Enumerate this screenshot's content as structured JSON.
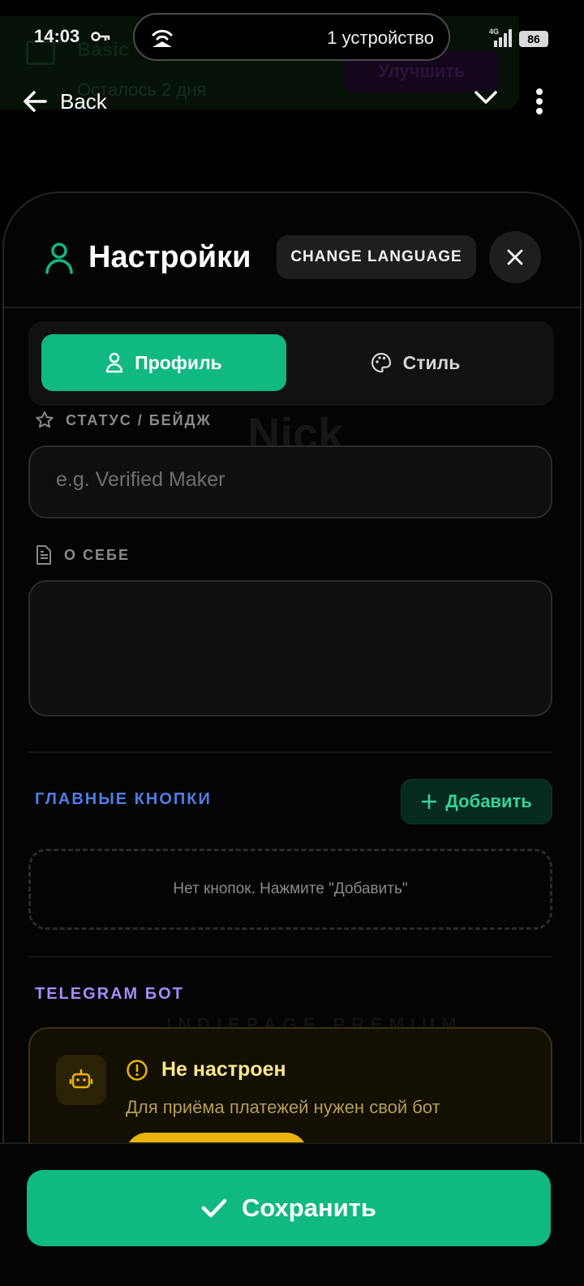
{
  "status_bar": {
    "time": "14:03",
    "devices": "1 устройство",
    "network": "4G",
    "battery": "86"
  },
  "background": {
    "trial_title": "Basic",
    "trial_remaining": "Осталось 2 дня",
    "upgrade_label": "Улучшить",
    "ghost_name": "Nick",
    "ghost_premium": "INDIEPAGE PREMIUM"
  },
  "header": {
    "back_label": "Back"
  },
  "sheet": {
    "title": "Настройки",
    "change_language": "CHANGE LANGUAGE",
    "tabs": [
      {
        "label": "Профиль",
        "active": true
      },
      {
        "label": "Стиль",
        "active": false
      }
    ],
    "status_badge": {
      "label": "СТАТУС / БЕЙДЖ",
      "placeholder": "e.g. Verified Maker",
      "value": ""
    },
    "about": {
      "label": "О СЕБЕ",
      "value": ""
    },
    "main_buttons": {
      "title": "ГЛАВНЫЕ КНОПКИ",
      "add_label": "Добавить",
      "empty_text": "Нет кнопок. Нажмите \"Добавить\""
    },
    "telegram_bot": {
      "title": "TELEGRAM БОТ",
      "status": "Не настроен",
      "description": "Для приёма платежей нужен свой бот"
    }
  },
  "footer": {
    "save_label": "Сохранить"
  },
  "colors": {
    "accent": "#10b981",
    "section_blue": "#4f7ee8",
    "section_purple": "#a78bfa",
    "warning": "#eab308"
  }
}
